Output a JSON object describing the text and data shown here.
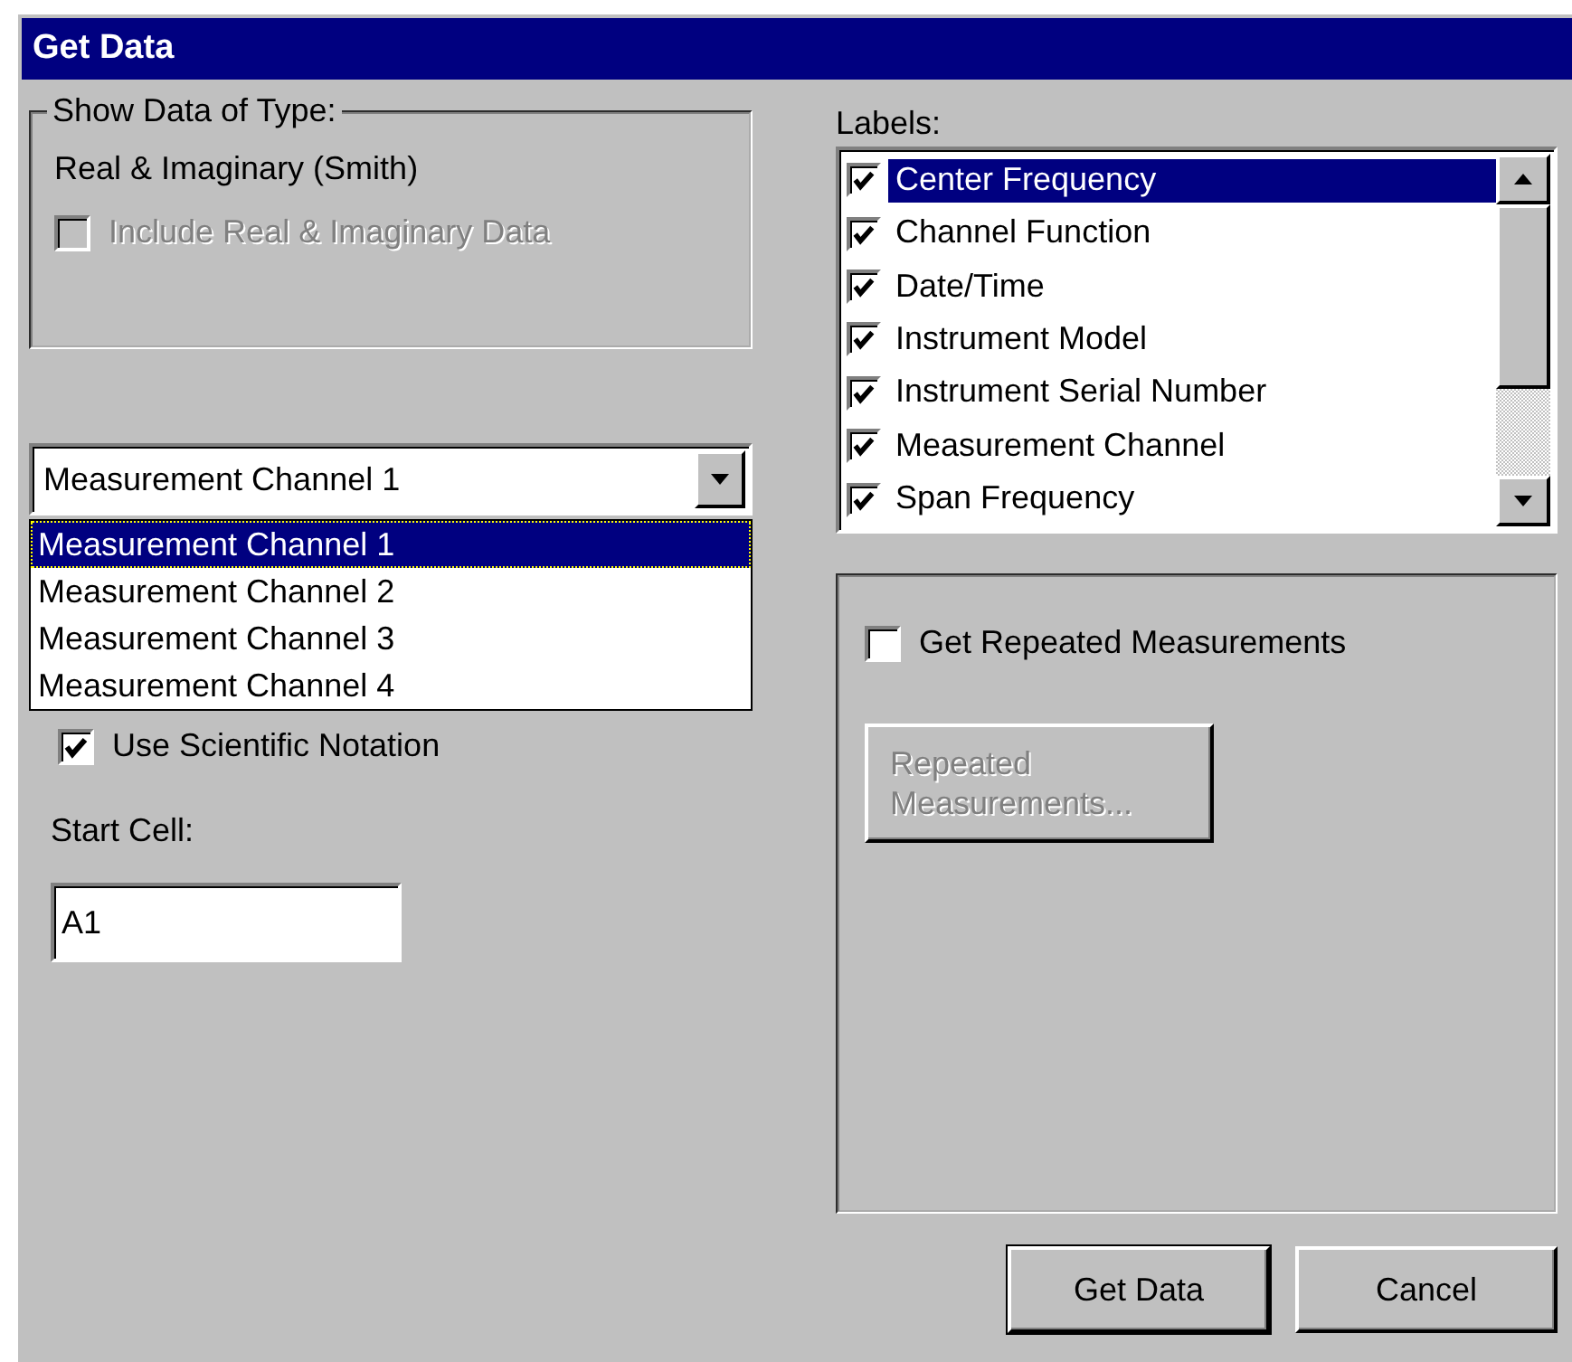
{
  "window": {
    "title": "Get Data"
  },
  "data_type_group": {
    "title": "Show Data of Type:",
    "value": "Real & Imaginary (Smith)",
    "include_checkbox": {
      "label": "Include Real & Imaginary Data",
      "checked": false,
      "disabled": true
    }
  },
  "channel_dropdown": {
    "value": "Measurement Channel 1",
    "expanded": true,
    "options": [
      {
        "label": "Measurement Channel 1",
        "selected": true
      },
      {
        "label": "Measurement Channel 2",
        "selected": false
      },
      {
        "label": "Measurement Channel 3",
        "selected": false
      },
      {
        "label": "Measurement Channel 4",
        "selected": false
      }
    ]
  },
  "scientific_notation": {
    "label": "Use Scientific Notation",
    "checked": true
  },
  "start_cell": {
    "label": "Start Cell:",
    "value": "A1"
  },
  "labels": {
    "title": "Labels:",
    "items": [
      {
        "label": "Center Frequency",
        "checked": true,
        "selected": true
      },
      {
        "label": "Channel Function",
        "checked": true,
        "selected": false
      },
      {
        "label": "Date/Time",
        "checked": true,
        "selected": false
      },
      {
        "label": "Instrument Model",
        "checked": true,
        "selected": false
      },
      {
        "label": "Instrument Serial Number",
        "checked": true,
        "selected": false
      },
      {
        "label": "Measurement Channel",
        "checked": true,
        "selected": false
      },
      {
        "label": "Span Frequency",
        "checked": true,
        "selected": false
      }
    ]
  },
  "repeated": {
    "checkbox": {
      "label": "Get Repeated Measurements",
      "checked": false
    },
    "button": {
      "label": "Repeated Measurements...",
      "disabled": true
    }
  },
  "buttons": [
    {
      "label": "Get Data",
      "default": true
    },
    {
      "label": "Cancel",
      "default": false
    }
  ]
}
